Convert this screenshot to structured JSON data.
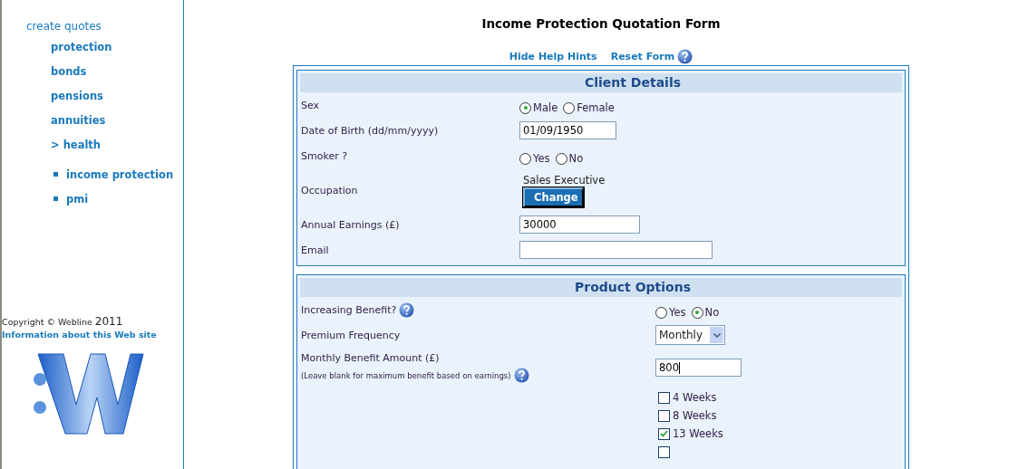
{
  "sidebar": {
    "heading": "create quotes",
    "items": [
      {
        "label": "protection"
      },
      {
        "label": "bonds"
      },
      {
        "label": "pensions"
      },
      {
        "label": "annuities"
      },
      {
        "label": "> health"
      }
    ],
    "subitems": [
      {
        "label": "income protection"
      },
      {
        "label": "pmi"
      }
    ],
    "copyright": "Copyright © Webline",
    "year": "2011",
    "info_link": "Information about this Web site"
  },
  "page": {
    "title": "Income Protection Quotation Form",
    "links": [
      "Hide Help Hints",
      "Reset Form"
    ]
  },
  "sections": [
    {
      "title": "Client Details",
      "rows": [
        {
          "kind": "radio",
          "label": "Sex",
          "options": [
            {
              "label": "Male",
              "selected": true
            },
            {
              "label": "Female",
              "selected": false
            }
          ]
        },
        {
          "kind": "date",
          "label": "Date of Birth (dd/mm/yyyy)",
          "value": "01/09/1950"
        },
        {
          "kind": "radio",
          "label": "Smoker ?",
          "options": [
            {
              "label": "Yes",
              "selected": false
            },
            {
              "label": "No",
              "selected": false
            }
          ]
        },
        {
          "kind": "occupation",
          "label": "Occupation",
          "value": "Sales Executive",
          "button": "Change"
        },
        {
          "kind": "text",
          "label": "Annual Earnings (£)",
          "value": "30000"
        },
        {
          "kind": "email",
          "label": "Email"
        }
      ]
    },
    {
      "title": "Product Options",
      "rows": [
        {
          "kind": "radio",
          "label": "Increasing Benefit?",
          "help": true,
          "options": [
            {
              "label": "Yes",
              "selected": false
            },
            {
              "label": "No",
              "selected": true
            }
          ]
        },
        {
          "kind": "select",
          "label": "Premium Frequency",
          "value": "Monthly"
        },
        {
          "kind": "text",
          "label": "Monthly Benefit Amount (£)",
          "note": "(Leave blank for maximum benefit based on earnings)",
          "help": true,
          "value": "800"
        },
        {
          "kind": "checkboxes",
          "options": [
            {
              "label": "4 Weeks",
              "checked": false
            },
            {
              "label": "8 Weeks",
              "checked": false
            },
            {
              "label": "13 Weeks",
              "checked": true
            },
            {
              "checked": false
            }
          ]
        }
      ]
    }
  ]
}
